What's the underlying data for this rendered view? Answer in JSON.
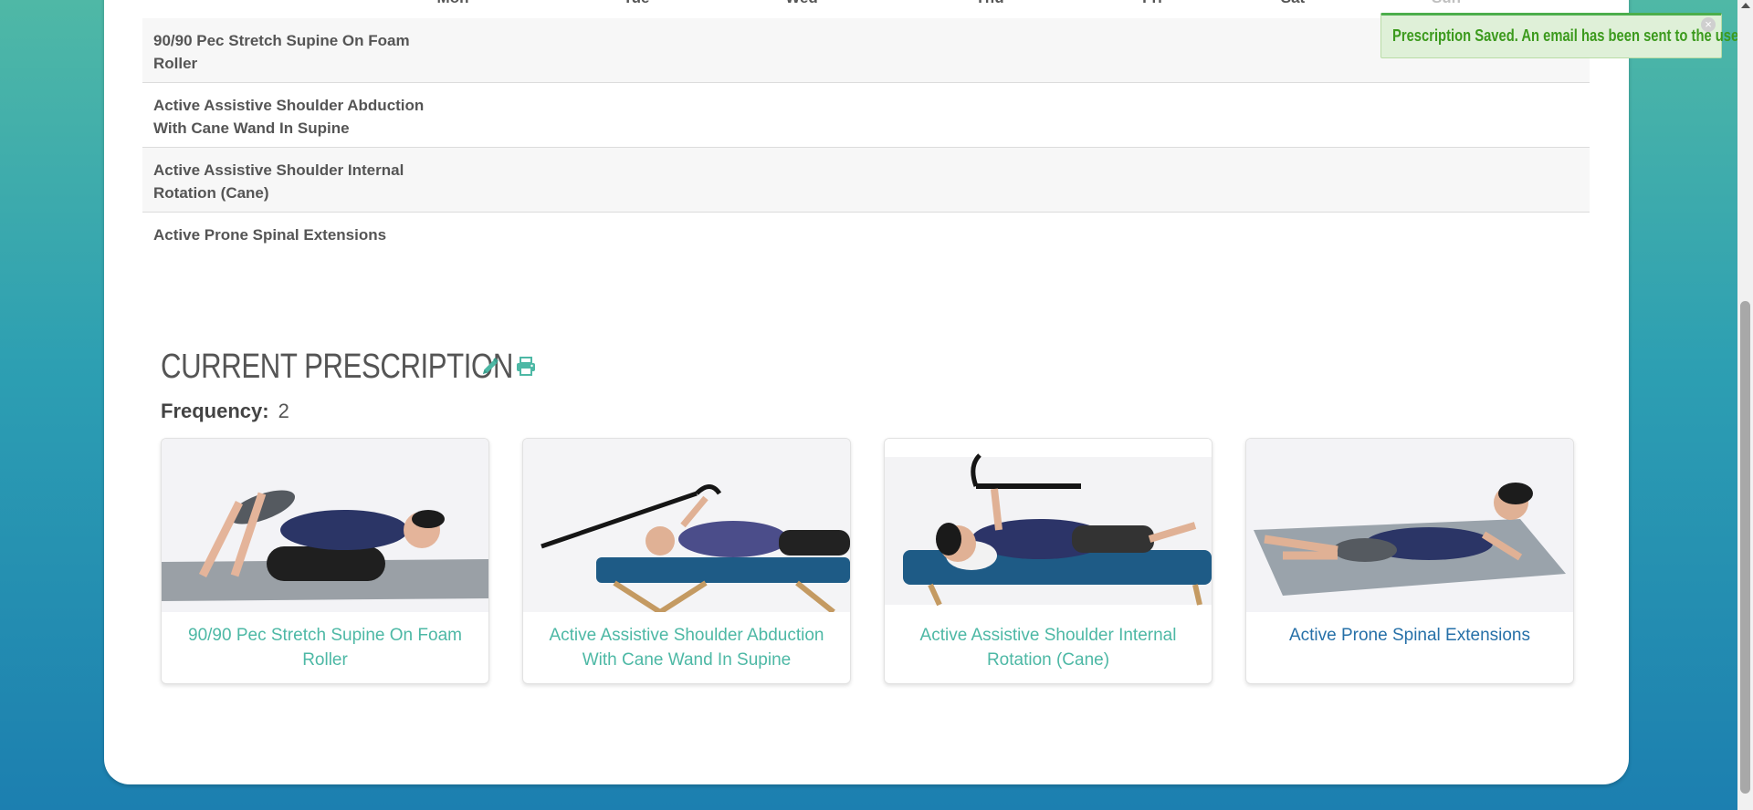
{
  "schedule": {
    "days": [
      "Mon",
      "Tue",
      "Wed",
      "Thu",
      "Fri",
      "Sat",
      "Sun"
    ],
    "rows": [
      "90/90 Pec Stretch Supine On Foam Roller",
      "Active Assistive Shoulder Abduction With Cane Wand In Supine",
      "Active Assistive Shoulder Internal Rotation (Cane)",
      "Active Prone Spinal Extensions"
    ]
  },
  "prescription": {
    "title": "CURRENT PRESCRIPTION",
    "edit_icon": "pencil-icon",
    "print_icon": "print-icon",
    "frequency_label": "Frequency:",
    "frequency_value": "2",
    "exercises": [
      {
        "name": "90/90 Pec Stretch Supine On Foam Roller"
      },
      {
        "name": "Active Assistive Shoulder Abduction With Cane Wand In Supine"
      },
      {
        "name": "Active Assistive Shoulder Internal Rotation (Cane)"
      },
      {
        "name": "Active Prone Spinal Extensions"
      }
    ]
  },
  "toast": {
    "message": "Prescription Saved. An email has been sent to the user."
  },
  "colors": {
    "accent": "#4db8a5",
    "link_blue": "#2670a8",
    "success_text": "#3c9a1d",
    "success_bg": "#dff0d8"
  }
}
